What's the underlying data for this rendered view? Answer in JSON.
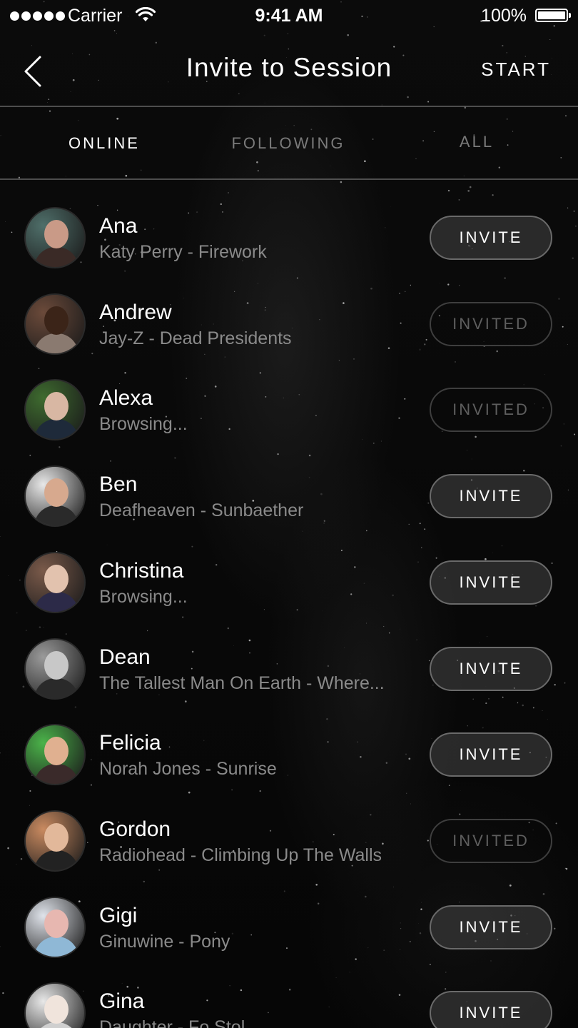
{
  "status_bar": {
    "carrier": "Carrier",
    "time": "9:41 AM",
    "battery": "100%"
  },
  "nav": {
    "title": "Invite to Session",
    "start_label": "START",
    "back_icon": "chevron-left-icon"
  },
  "tabs": [
    {
      "label": "ONLINE",
      "active": true
    },
    {
      "label": "FOLLOWING",
      "active": false
    },
    {
      "label": "ALL",
      "active": false
    }
  ],
  "contacts": [
    {
      "name": "Ana",
      "status": "Katy Perry - Firework",
      "button": "INVITE",
      "invited": false,
      "avatar_colors": [
        "#4f6f6a",
        "#c99a87",
        "#3a2a26"
      ]
    },
    {
      "name": "Andrew",
      "status": "Jay-Z - Dead Presidents",
      "button": "INVITED",
      "invited": true,
      "avatar_colors": [
        "#6b4a3a",
        "#3b2418",
        "#8a7a70"
      ]
    },
    {
      "name": "Alexa",
      "status": "Browsing...",
      "button": "INVITED",
      "invited": true,
      "avatar_colors": [
        "#3e6b2f",
        "#d8b7a3",
        "#1e2a3a"
      ]
    },
    {
      "name": "Ben",
      "status": "Deafheaven - Sunbaether",
      "button": "INVITE",
      "invited": false,
      "avatar_colors": [
        "#e8e8e8",
        "#d7a98e",
        "#2a2a2a"
      ]
    },
    {
      "name": "Christina",
      "status": "Browsing...",
      "button": "INVITE",
      "invited": false,
      "avatar_colors": [
        "#7a5a4a",
        "#e2c2ae",
        "#2c2a48"
      ]
    },
    {
      "name": "Dean",
      "status": "The Tallest Man On Earth - Where...",
      "button": "INVITE",
      "invited": false,
      "avatar_colors": [
        "#9a9a9a",
        "#c8c8c8",
        "#2a2a2a"
      ]
    },
    {
      "name": "Felicia",
      "status": "Norah Jones - Sunrise",
      "button": "INVITE",
      "invited": false,
      "avatar_colors": [
        "#4bb34a",
        "#e0b090",
        "#3a2a2a"
      ]
    },
    {
      "name": "Gordon",
      "status": "Radiohead - Climbing Up The Walls",
      "button": "INVITED",
      "invited": true,
      "avatar_colors": [
        "#c98a60",
        "#e2b89a",
        "#222222"
      ]
    },
    {
      "name": "Gigi",
      "status": "Ginuwine - Pony",
      "button": "INVITE",
      "invited": false,
      "avatar_colors": [
        "#dfe3ea",
        "#e7b7b0",
        "#8fb8d6"
      ]
    },
    {
      "name": "Gina",
      "status": "Daughter - Fo Stol",
      "button": "INVITE",
      "invited": false,
      "avatar_colors": [
        "#e8e8e8",
        "#f0e4dc",
        "#cfcfcf"
      ]
    }
  ]
}
